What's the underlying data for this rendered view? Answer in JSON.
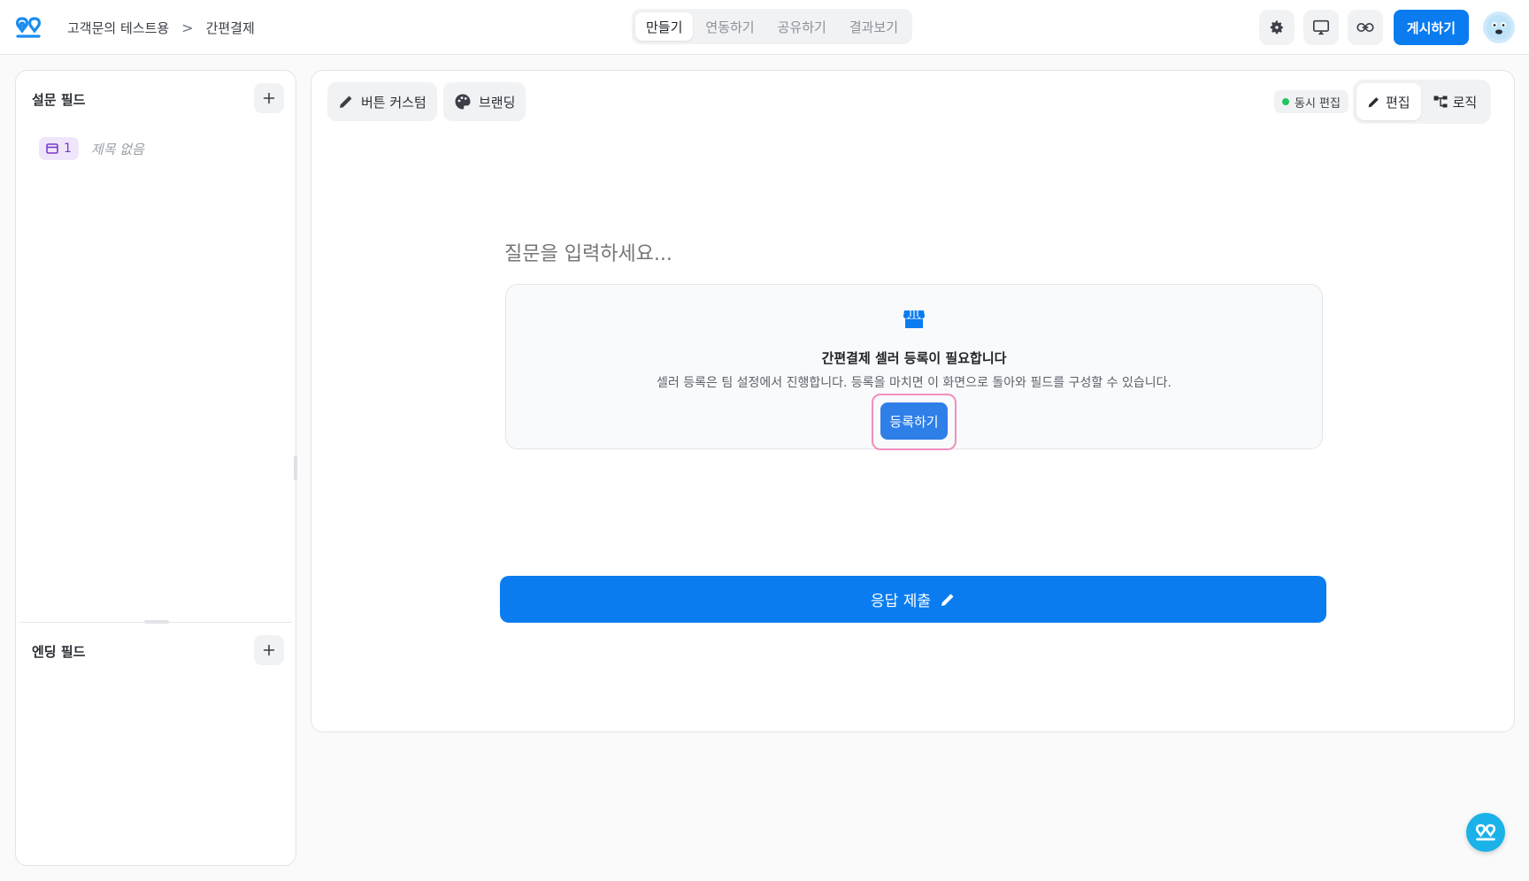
{
  "breadcrumb": {
    "workspace": "고객문의 테스트용",
    "separator": ">",
    "page": "간편결제"
  },
  "mode_tabs": [
    {
      "label": "만들기",
      "active": true
    },
    {
      "label": "연동하기",
      "active": false
    },
    {
      "label": "공유하기",
      "active": false
    },
    {
      "label": "결과보기",
      "active": false
    }
  ],
  "top_actions": {
    "icons": [
      "gear-icon",
      "monitor-icon",
      "link-icon"
    ],
    "publish_label": "게시하기"
  },
  "left_panel": {
    "survey_fields_title": "설문 필드",
    "fields": [
      {
        "number": "1",
        "title": "제목 없음",
        "icon": "payment-card-icon"
      }
    ],
    "ending_fields_title": "엔딩 필드"
  },
  "canvas": {
    "toolbar": {
      "button_custom_label": "버튼 커스텀",
      "branding_label": "브랜딩",
      "live_edit_label": "동시 편집",
      "edit_label": "편집",
      "logic_label": "로직"
    },
    "question_placeholder": "질문을 입력하세요...",
    "notice": {
      "title": "간편결제 셀러 등록이 필요합니다",
      "description": "셀러 등록은 팀 설정에서 진행합니다. 등록을 마치면 이 화면으로 돌아와 필드를 구성할 수 있습니다.",
      "register_label": "등록하기"
    },
    "submit_label": "응답 제출"
  },
  "colors": {
    "primary": "#0a7cf0",
    "register_button": "#2f7fe8",
    "highlight_outline": "#f08fc0",
    "field_badge_bg": "#f0e6fb",
    "field_badge_fg": "#7a3ac9",
    "live_dot": "#22c55e",
    "help_fab": "#1ab2e8"
  }
}
